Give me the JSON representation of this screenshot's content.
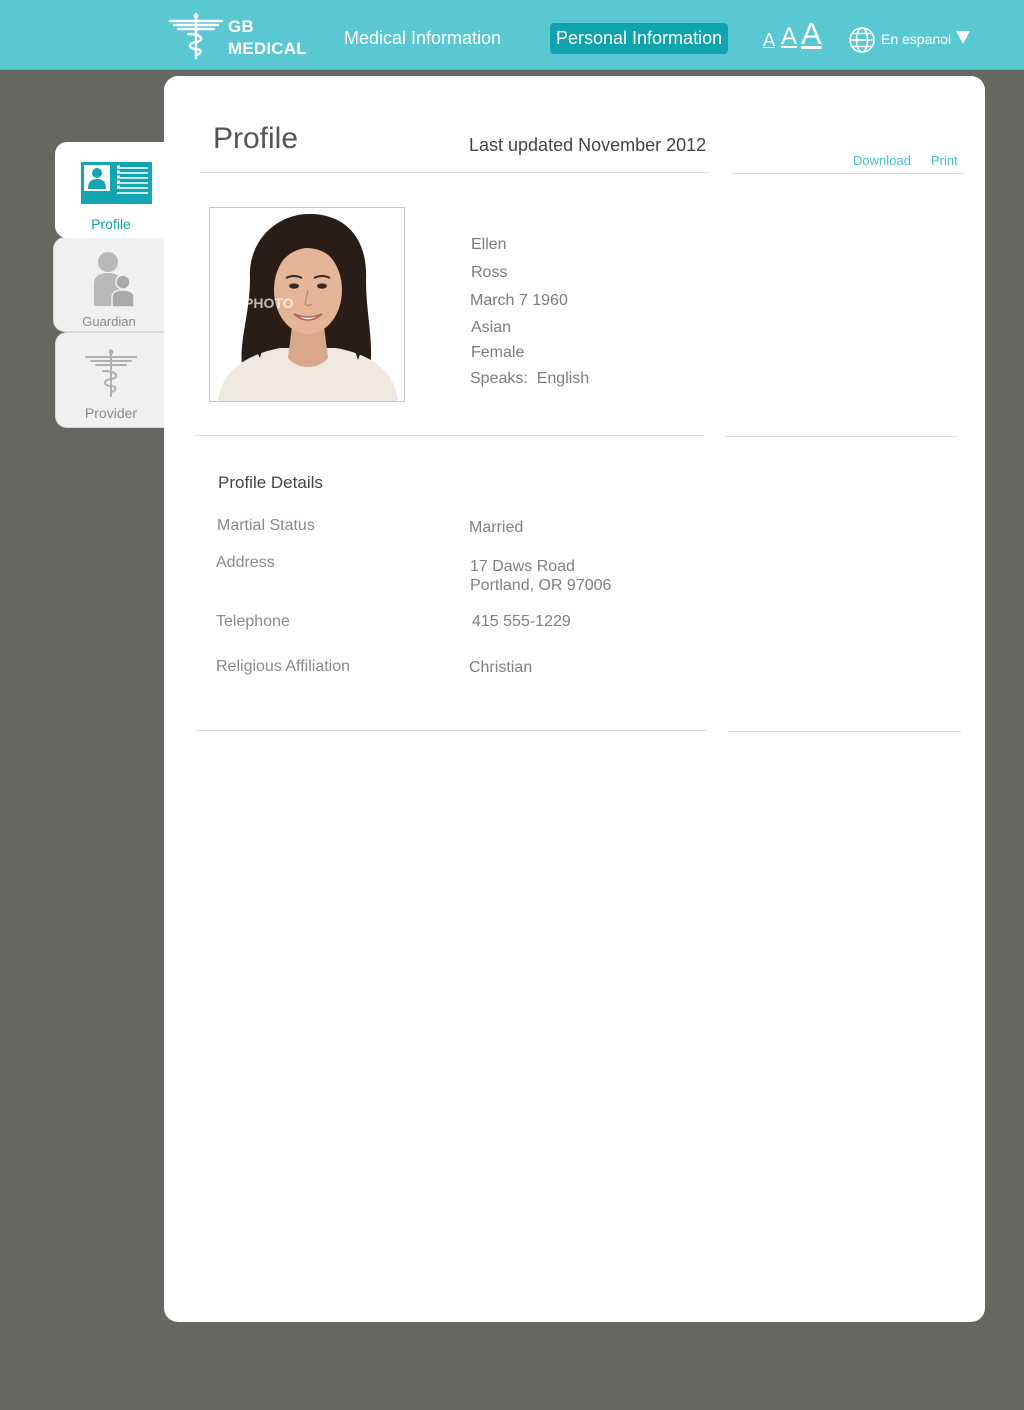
{
  "header": {
    "logo_line1": "GB",
    "logo_line2": "MEDICAL",
    "nav_medical": "Medical Information",
    "nav_personal": "Personal Information",
    "font_small": "A",
    "font_medium": "A",
    "font_large": "A",
    "language": "En espanol"
  },
  "sidebar": {
    "tabs": [
      {
        "label": "Profile",
        "icon": "profile-card-icon",
        "active": true
      },
      {
        "label": "Guardian",
        "icon": "guardian-icon",
        "active": false
      },
      {
        "label": "Provider",
        "icon": "caduceus-icon",
        "active": false
      }
    ]
  },
  "profile": {
    "title": "Profile",
    "last_updated": "Last updated November 2012",
    "download_label": "Download",
    "print_label": "Print",
    "photo_alt": "Profile photo",
    "first_name": "Ellen",
    "last_name": "Ross",
    "birth_date": "March 7 1960",
    "ethnicity": "Asian",
    "gender": "Female",
    "speaks_label": "Speaks:",
    "speaks_value": "English"
  },
  "details": {
    "title": "Profile Details",
    "marital_label": "Martial Status",
    "marital_value": "Married",
    "address_label": "Address",
    "address_line1": "17 Daws Road",
    "address_line2": "Portland, OR 97006",
    "telephone_label": "Telephone",
    "telephone_value": "415 555-1229",
    "religion_label": "Religious Affiliation",
    "religion_value": "Christian"
  },
  "colors": {
    "header": "#5ac8d3",
    "accent": "#0fa3b0",
    "link": "#45c0cf",
    "background": "#676762"
  }
}
